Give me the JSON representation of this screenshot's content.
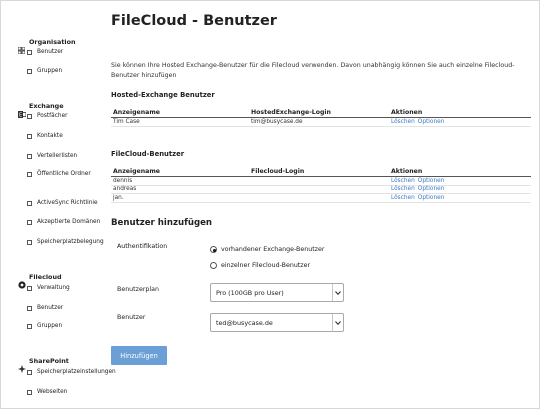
{
  "sidebar": {
    "sections": [
      {
        "label": "Organisation",
        "icon": "grid-icon",
        "items": [
          "Benutzer",
          "Gruppen"
        ]
      },
      {
        "label": "Exchange",
        "icon": "exchange-icon",
        "items": [
          "Postfächer",
          "Kontakte",
          "Verteilerlisten",
          "Öffentliche Ordner",
          "ActiveSync Richtlinie",
          "Akzeptierte Domänen",
          "Speicherplatzbelegung"
        ]
      },
      {
        "label": "Filecloud",
        "icon": "filecloud-icon",
        "items": [
          "Verwaltung",
          "Benutzer",
          "Gruppen"
        ]
      },
      {
        "label": "SharePoint",
        "icon": "sharepoint-icon",
        "items": [
          "Speicherplatzeinstellungen",
          "Webseiten"
        ]
      }
    ]
  },
  "page": {
    "title": "FileCloud - Benutzer",
    "intro": "Sie können Ihre Hosted Exchange-Benutzer für die Filecloud verwenden. Davon unabhängig können Sie auch einzelne Filecloud-Benutzer hinzufügen"
  },
  "hosted_table": {
    "heading": "Hosted-Exchange Benutzer",
    "columns": [
      "Anzeigename",
      "HostedExchange-Login",
      "Aktionen"
    ],
    "rows": [
      {
        "name": "Tim Case",
        "login": "tim@busycase.de",
        "delete": "Löschen",
        "options": "Optionen"
      }
    ]
  },
  "filecloud_table": {
    "heading": "FileCloud-Benutzer",
    "columns": [
      "Anzeigename",
      "Filecloud-Login",
      "Aktionen"
    ],
    "rows": [
      {
        "name": "dennis",
        "login": "",
        "delete": "Löschen",
        "options": "Optionen"
      },
      {
        "name": "andreas",
        "login": "",
        "delete": "Löschen",
        "options": "Optionen"
      },
      {
        "name": "jan.",
        "login": "",
        "delete": "Löschen",
        "options": "Optionen"
      }
    ]
  },
  "add_form": {
    "heading": "Benutzer hinzufügen",
    "auth_label": "Authentifikation",
    "radio_options": [
      {
        "label": "vorhandener Exchange-Benutzer",
        "checked": true
      },
      {
        "label": "einzelner Filecloud-Benutzer",
        "checked": false
      }
    ],
    "plan_label": "Benutzerplan",
    "plan_value": "Pro (100GB pro User)",
    "user_label": "Benutzer",
    "user_value": "ted@busycase.de",
    "submit_label": "Hinzufügen"
  }
}
